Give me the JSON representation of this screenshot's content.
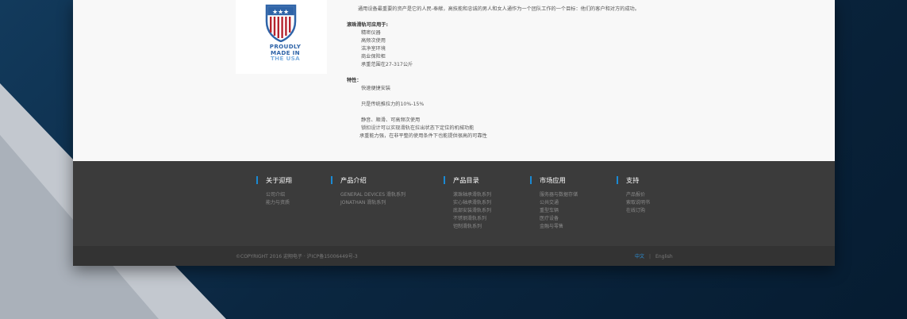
{
  "content": {
    "intro": "通用设备最重要的资产是它的人民-奉献，高技能和忠诚的男人和女人通作为一个团队工作的一个目标：他们的客户和对方的成功。",
    "logo": {
      "line1": "PROUDLY",
      "line2": "MADE IN",
      "line3": "THE USA"
    },
    "applications": {
      "heading": "滚珠滑轨可应用于:",
      "items": [
        "精密仪器",
        "高频次使用",
        "洁净室环境",
        "商业保险柜",
        "承重范围在27-317公斤"
      ]
    },
    "features": {
      "heading": "特性：",
      "items": [
        "快速便捷安装",
        "只是传统推拉力的10%-15%",
        "静音、顺滑、可高频次使用",
        "锁扣设计可以实现滑轨在拉出状态下定位的机械功能",
        "承重能力强，在非平整的使用条件下也能提供很高的可靠性"
      ]
    }
  },
  "footer": {
    "columns": [
      {
        "title": "关于迎翔",
        "items": [
          "公司介绍",
          "能力与资质"
        ]
      },
      {
        "title": "产品介绍",
        "items": [
          "GENERAL DEVICES 滑轨系列",
          "JONATHAN 滑轨系列"
        ]
      },
      {
        "title": "产品目录",
        "items": [
          "滚珠轴承滑轨系列",
          "实心轴承滑轨系列",
          "底部安装滑轨系列",
          "不锈钢滑轨系列",
          "钽制滑轨系列"
        ]
      },
      {
        "title": "市场应用",
        "items": [
          "服务器与数据存储",
          "公共交通",
          "重型车辆",
          "医疗设备",
          "金融与零售"
        ]
      },
      {
        "title": "支持",
        "items": [
          "产品报价",
          "索取说明书",
          "在线订购"
        ]
      }
    ],
    "copyright": "©COPYRIGHT 2016  迎翔电子 · 沪ICP备15006449号-3",
    "lang_active": "中文",
    "lang_sep": "|",
    "lang_other": "English"
  },
  "colors": {
    "accent": "#1a8ad4",
    "footer_bg": "#3b3b3b",
    "logo_blue": "#2f64a8",
    "logo_red": "#b5232e"
  }
}
